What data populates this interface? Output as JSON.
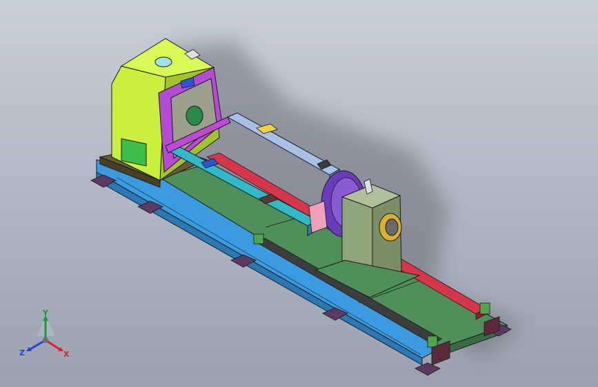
{
  "window": {
    "title": ""
  },
  "model": {
    "name": "",
    "colors": {
      "headstock": "#c8f03c",
      "headstock_dark": "#a2c42a",
      "faceplate_frame": "#b44ad6",
      "faceplate": "#9aa08c",
      "base_rail": "#3a9be0",
      "bed": "#4f8f5a",
      "tailstock": "#8fa57a",
      "red_rail": "#d8344a",
      "feet": "#5a3a62",
      "arm_top": "#a6c0e8",
      "arm_side": "#2fb9c9",
      "yellow_pad": "#f2d23a",
      "outline": "#1a1a1a"
    }
  },
  "triad": {
    "x_label": "X",
    "y_label": "Y",
    "z_label": "Z",
    "colors": {
      "x": "#e02020",
      "y": "#10a030",
      "z": "#2040e0"
    }
  }
}
